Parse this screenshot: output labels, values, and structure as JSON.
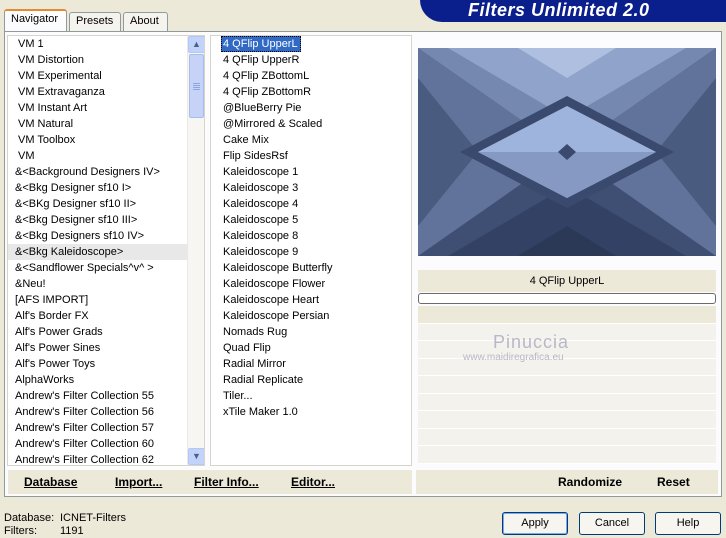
{
  "tabs": [
    "Navigator",
    "Presets",
    "About"
  ],
  "banner_title": "Filters Unlimited 2.0",
  "categories": [
    "VM 1",
    "VM Distortion",
    "VM Experimental",
    "VM Extravaganza",
    "VM Instant Art",
    "VM Natural",
    "VM Toolbox",
    "VM",
    "&<Background Designers IV>",
    "&<Bkg Designer sf10 I>",
    "&<BKg Designer sf10 II>",
    "&<Bkg Designer sf10 III>",
    "&<Bkg Designers sf10 IV>",
    "&<Bkg Kaleidoscope>",
    "&<Sandflower Specials^v^ >",
    "&Neu!",
    "[AFS IMPORT]",
    "Alf's Border FX",
    "Alf's Power Grads",
    "Alf's Power Sines",
    "Alf's Power Toys",
    "AlphaWorks",
    "Andrew's Filter Collection 55",
    "Andrew's Filter Collection 56",
    "Andrew's Filter Collection 57",
    "Andrew's Filter Collection 60",
    "Andrew's Filter Collection 62"
  ],
  "selected_category_index": 13,
  "filters": [
    "4 QFlip UpperL",
    "4 QFlip UpperR",
    "4 QFlip ZBottomL",
    "4 QFlip ZBottomR",
    "@BlueBerry Pie",
    "@Mirrored & Scaled",
    "Cake Mix",
    "Flip SidesRsf",
    "Kaleidoscope 1",
    "Kaleidoscope 3",
    "Kaleidoscope 4",
    "Kaleidoscope 5",
    "Kaleidoscope 8",
    "Kaleidoscope 9",
    "Kaleidoscope Butterfly",
    "Kaleidoscope Flower",
    "Kaleidoscope Heart",
    "Kaleidoscope Persian",
    "Nomads Rug",
    "Quad Flip",
    "Radial Mirror",
    "Radial Replicate",
    "Tiler...",
    "xTile Maker 1.0"
  ],
  "selected_filter_index": 0,
  "selected_filter_name": "4 QFlip UpperL",
  "watermark": {
    "line1": "Pinuccia",
    "line2": "www.maidiregrafica.eu"
  },
  "left_actions": {
    "database": "Database",
    "import": "Import...",
    "filter_info": "Filter Info...",
    "editor": "Editor..."
  },
  "right_actions": {
    "randomize": "Randomize",
    "reset": "Reset"
  },
  "status": {
    "database_label": "Database:",
    "database_value": "ICNET-Filters",
    "filters_label": "Filters:",
    "filters_value": "1191"
  },
  "buttons": {
    "apply": "Apply",
    "cancel": "Cancel",
    "help": "Help"
  },
  "icons": {
    "scroll_up": "chevron-up-icon",
    "scroll_down": "chevron-down-icon"
  },
  "colors": {
    "banner": "#0a1e8c",
    "selection": "#316ac5",
    "active_tab_accent": "#e68b2c"
  }
}
